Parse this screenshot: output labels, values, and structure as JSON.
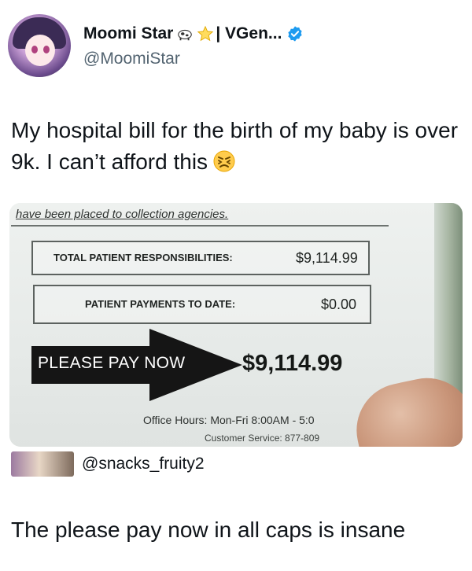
{
  "author": {
    "display_name": "Moomi Star",
    "name_suffix": "| VGen...",
    "handle": "@MoomiStar",
    "badges": [
      "cow-emoji-icon",
      "star-emoji-icon",
      "verified-badge-icon"
    ]
  },
  "tweet": {
    "text": "My hospital bill for the birth of my baby is over 9k. I can’t afford this",
    "emoji": "angry-face-emoji-icon"
  },
  "bill": {
    "collection_text": "have been placed to collection agencies.",
    "total_label": "TOTAL PATIENT RESPONSIBILITIES:",
    "total_value": "$9,114.99",
    "payments_label": "PATIENT PAYMENTS TO DATE:",
    "payments_value": "$0.00",
    "please_pay": "PLEASE PAY NOW",
    "amount_due": "$9,114.99",
    "office_hours": "Office Hours: Mon-Fri 8:00AM - 5:0",
    "customer_service": "Customer Service: 877-809"
  },
  "reply": {
    "handle": "@snacks_fruity2",
    "text": "The please pay now in all caps is insane"
  },
  "colors": {
    "text_primary": "#0f1419",
    "text_secondary": "#536471",
    "verified_blue": "#1d9bf0"
  }
}
